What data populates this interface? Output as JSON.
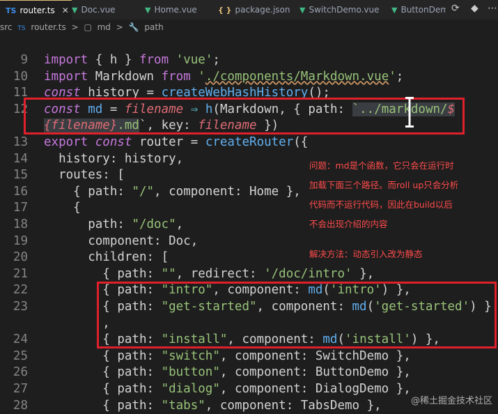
{
  "tabs": [
    {
      "label": "router.ts",
      "icon": "TS",
      "active": true
    },
    {
      "label": "Doc.vue",
      "icon": "V"
    },
    {
      "label": "Home.vue",
      "icon": "V"
    },
    {
      "label": "package.json",
      "icon": "{ }"
    },
    {
      "label": "SwitchDemo.vue",
      "icon": "V"
    },
    {
      "label": "ButtonDem",
      "icon": "V"
    }
  ],
  "breadcrumb": [
    "src",
    "TS",
    "router.ts",
    ">",
    "md",
    ">",
    "path"
  ],
  "lines": [
    {
      "n": "9"
    },
    {
      "n": "10"
    },
    {
      "n": "11"
    },
    {
      "n": "12"
    },
    {
      "n": "13"
    },
    {
      "n": "14"
    },
    {
      "n": "15"
    },
    {
      "n": "16"
    },
    {
      "n": "17"
    },
    {
      "n": "18"
    },
    {
      "n": "19"
    },
    {
      "n": "20"
    },
    {
      "n": "21"
    },
    {
      "n": "22"
    },
    {
      "n": "23"
    },
    {
      "n": "24"
    },
    {
      "n": "25"
    },
    {
      "n": "26"
    },
    {
      "n": "27"
    },
    {
      "n": "28"
    }
  ],
  "annotation": {
    "line1": "问题：md是个函数，它只会在运行时",
    "line2": "加载下面三个路径。而roll up只会分析",
    "line3": "代码而不运行代码，因此在build以后",
    "line4": "不会出现介绍的内容",
    "solution": "解决方法：动态引入改为静态"
  },
  "watermark": "@稀土掘金技术社区",
  "colors": {
    "accent_box": "#e0202a",
    "annotation": "#ff4b4b",
    "background": "#1e1e1e"
  }
}
